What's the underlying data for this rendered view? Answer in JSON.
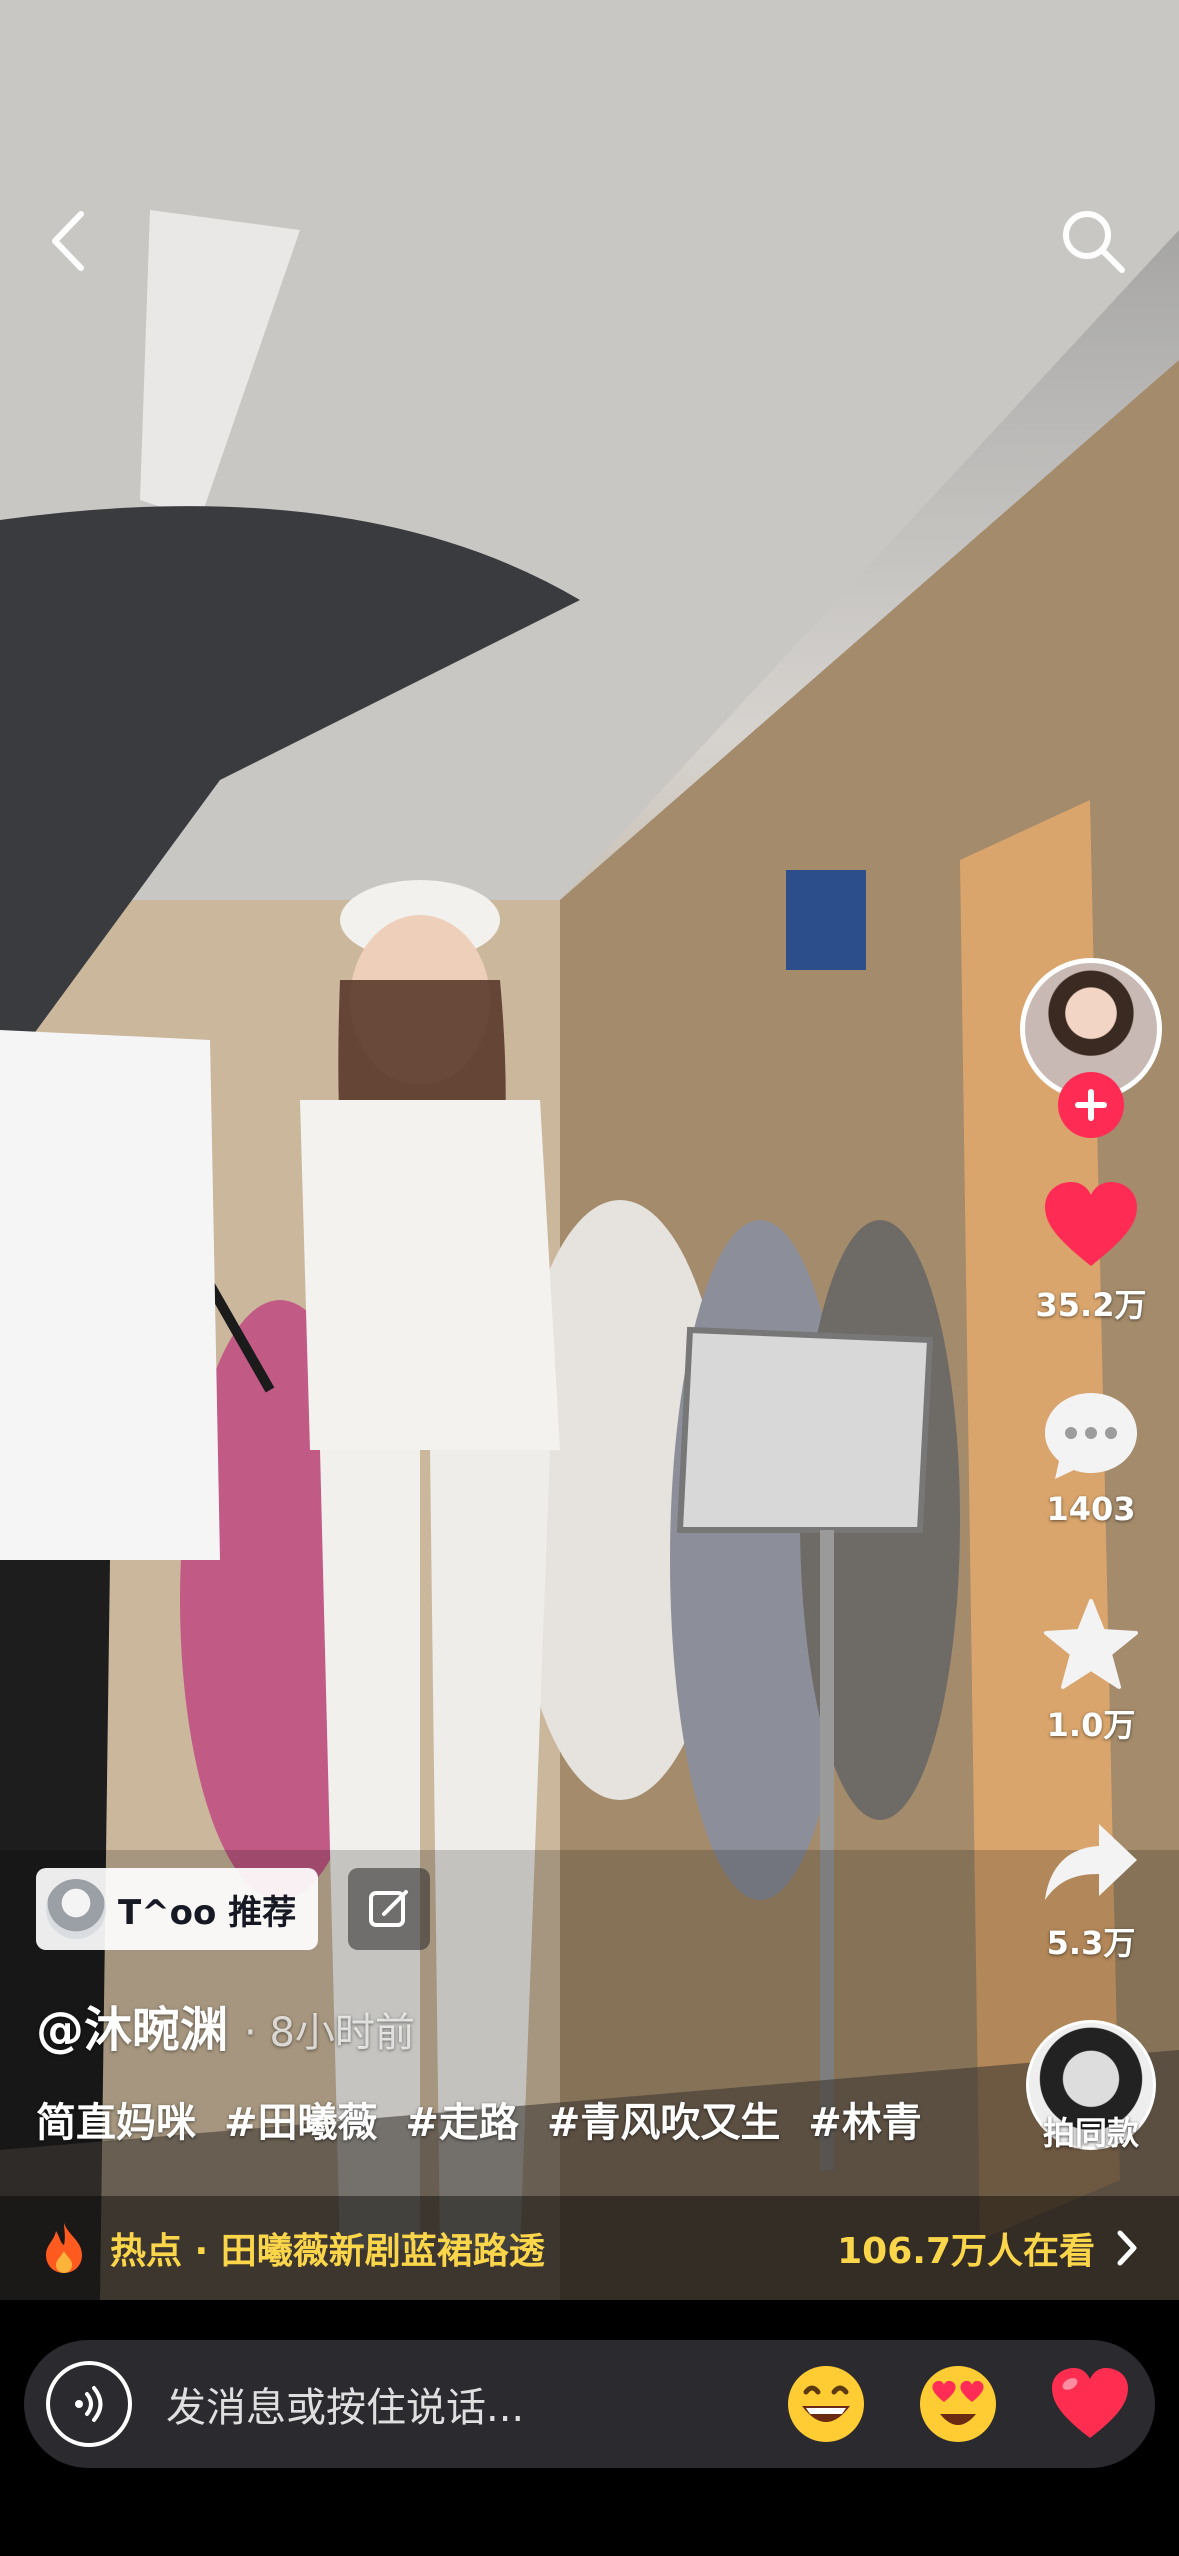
{
  "tag_chip": {
    "label": "T^oo 推荐"
  },
  "author": {
    "name": "@沐晼渊",
    "time": "· 8小时前"
  },
  "caption": {
    "text": "简直妈咪",
    "hashtags": [
      "#田曦薇",
      "#走路",
      "#青风吹又生",
      "#林青"
    ]
  },
  "rail": {
    "likes": "35.2万",
    "comments": "1403",
    "favorites": "1.0万",
    "shares": "5.3万",
    "music_label": "拍同款"
  },
  "hot_bar": {
    "title": "热点 · 田曦薇新剧蓝裙路透",
    "viewers": "106.7万人在看"
  },
  "message": {
    "placeholder": "发消息或按住说话..."
  },
  "colors": {
    "accent": "#fe2c55",
    "hot": "#fbd54a",
    "input_bg": "#2b2b2f"
  },
  "icons": [
    "back-icon",
    "search-icon",
    "plus-icon",
    "heart-icon",
    "comment-icon",
    "star-icon",
    "share-icon",
    "edit-icon",
    "fire-icon",
    "chevron-right-icon",
    "voice-icon",
    "grin-emoji-icon",
    "heart-eyes-emoji-icon",
    "red-heart-icon"
  ]
}
